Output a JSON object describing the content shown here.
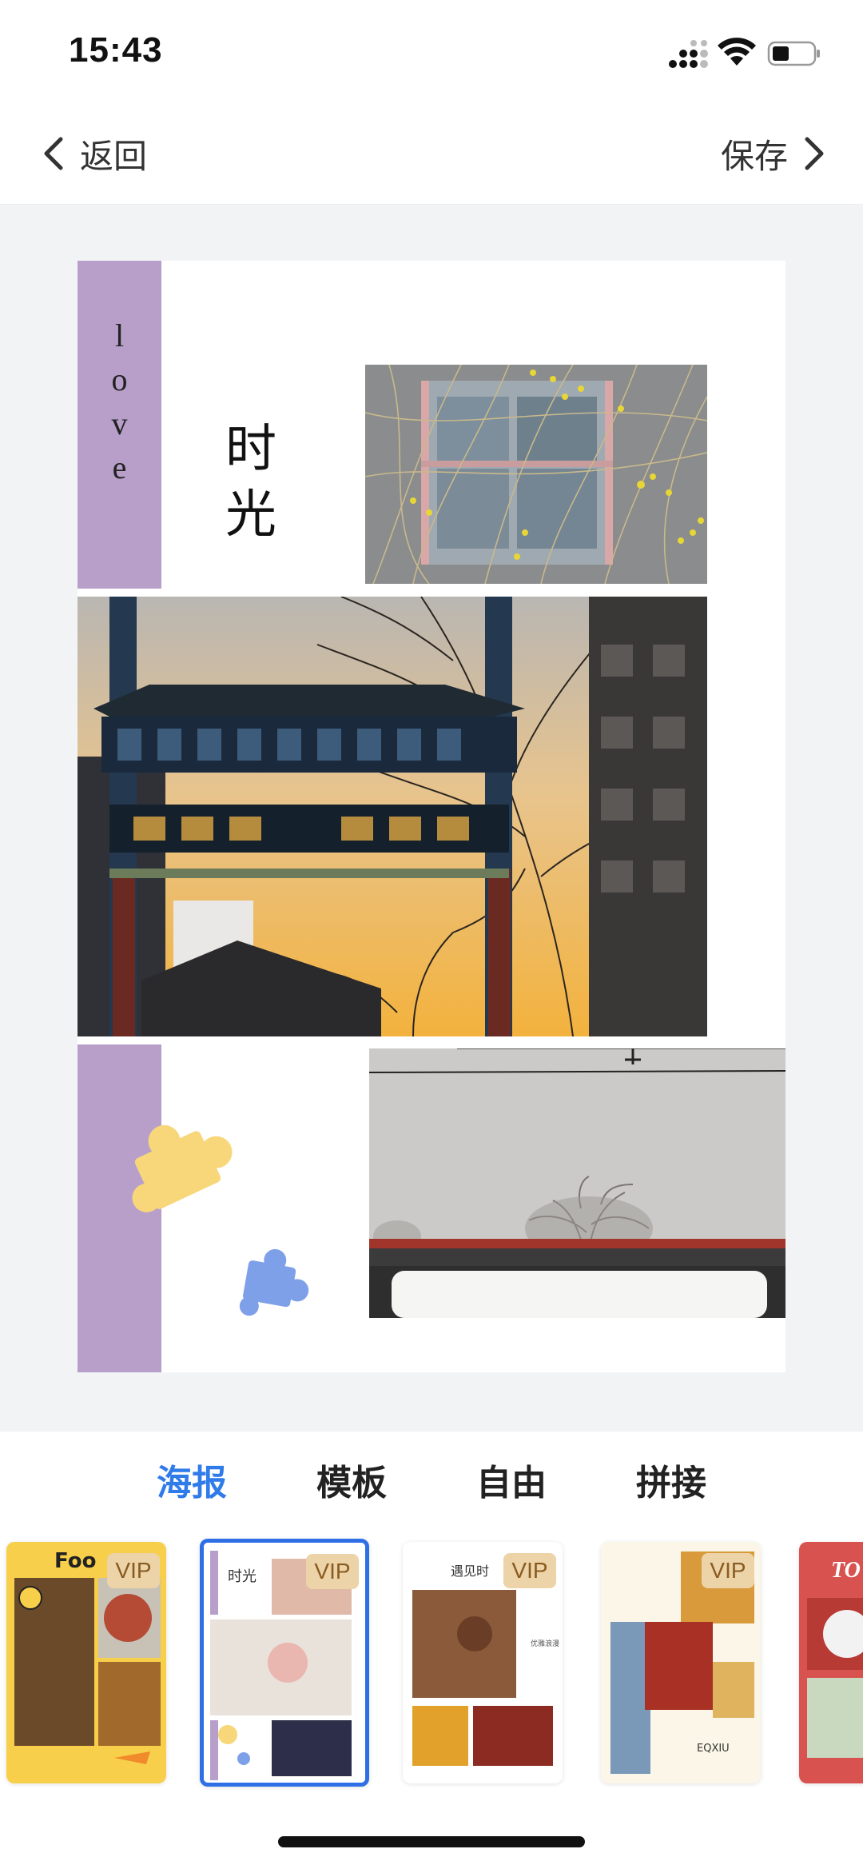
{
  "status_bar": {
    "time": "15:43"
  },
  "nav": {
    "back_label": "返回",
    "save_label": "保存"
  },
  "poster": {
    "love_letters": [
      "l",
      "o",
      "v",
      "e"
    ],
    "title_chars": [
      "时",
      "光"
    ]
  },
  "tabs": [
    {
      "label": "海报",
      "active": true
    },
    {
      "label": "模板",
      "active": false
    },
    {
      "label": "自由",
      "active": false
    },
    {
      "label": "拼接",
      "active": false
    }
  ],
  "templates": [
    {
      "badge": "VIP",
      "header_text": "Foo",
      "selected": false
    },
    {
      "badge": "VIP",
      "header_text": "时光",
      "selected": true
    },
    {
      "badge": "VIP",
      "header_text": "遇见时",
      "side_text": "优雅浪漫",
      "selected": false
    },
    {
      "badge": "VIP",
      "brand_text": "EQXIU",
      "selected": false
    },
    {
      "badge": "",
      "header_text": "TO",
      "selected": false
    }
  ],
  "colors": {
    "accent": "#2f7bea",
    "purple_bar": "#b89fca",
    "vip_badge": "#ecd3a8"
  }
}
